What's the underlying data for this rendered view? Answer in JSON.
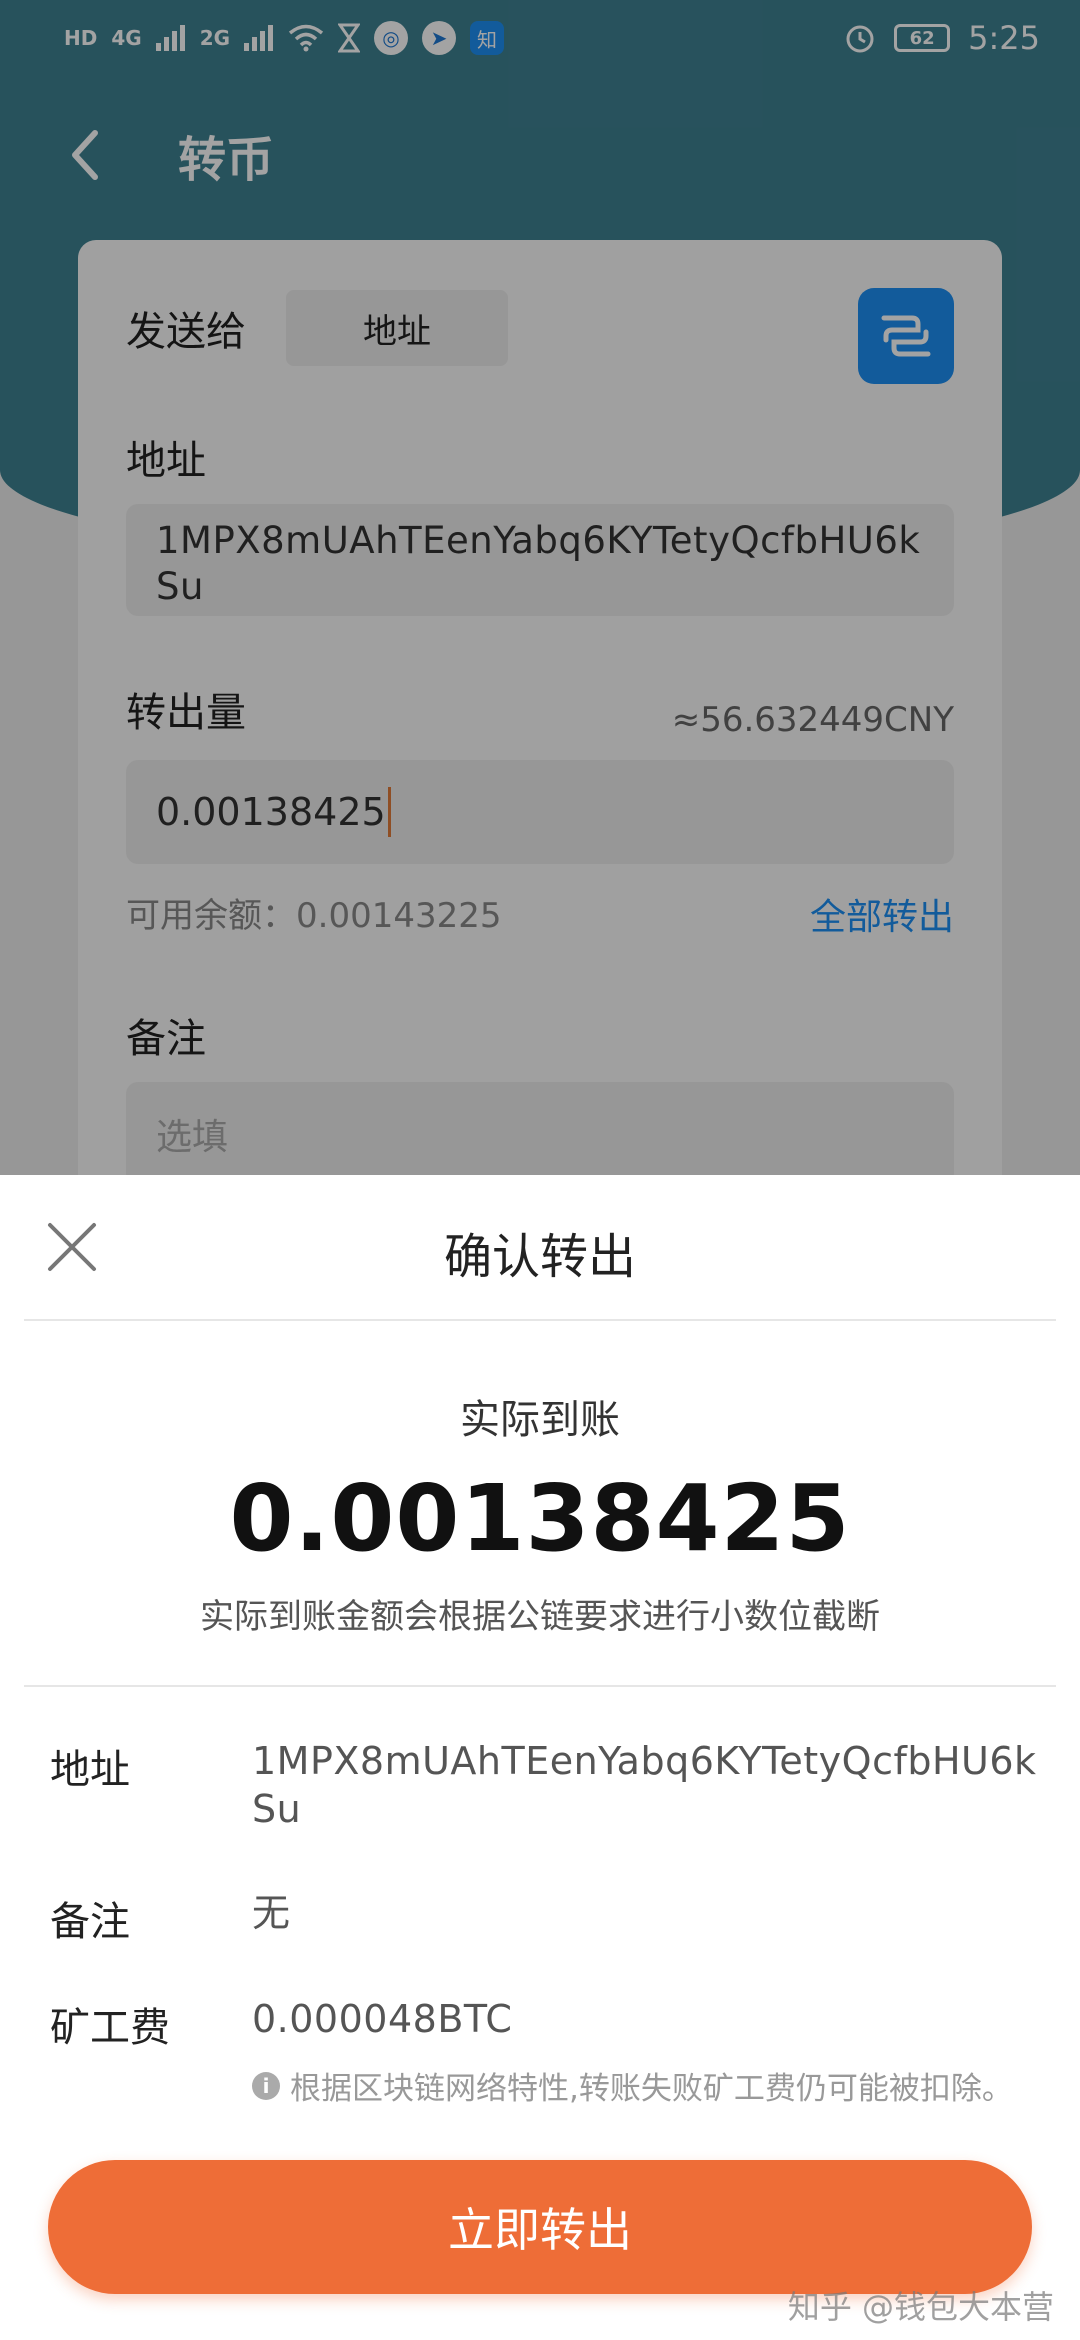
{
  "status_bar": {
    "left_chips": [
      "HD",
      "4G",
      "2G"
    ],
    "app_badge": "知",
    "battery": "62",
    "time": "5:25"
  },
  "nav": {
    "title": "转币"
  },
  "form": {
    "send_to_label": "发送给",
    "send_to_chip": "地址",
    "address_label": "地址",
    "address_value": "1MPX8mUAhTEenYabq6KYTetyQcfbHU6kSu",
    "amount_label": "转出量",
    "cny_estimate": "≈56.632449CNY",
    "amount_value": "0.00138425",
    "balance_text": "可用余额：0.00143225",
    "transfer_all": "全部转出",
    "memo_label": "备注",
    "memo_placeholder": "选填"
  },
  "sheet": {
    "title": "确认转出",
    "arrival_label": "实际到账",
    "arrival_value": "0.00138425",
    "arrival_note": "实际到账金额会根据公链要求进行小数位截断",
    "details": {
      "address_label": "地址",
      "address_value": "1MPX8mUAhTEenYabq6KYTetyQcfbHU6kSu",
      "memo_label": "备注",
      "memo_value": "无",
      "fee_label": "矿工费",
      "fee_value": "0.000048BTC",
      "fee_note": "根据区块链网络特性,转账失败矿工费仍可能被扣除。"
    },
    "submit_label": "立即转出"
  },
  "watermark": "知乎 @钱包大本营",
  "colors": {
    "header_teal": "#3e8191",
    "accent_blue": "#1d8ff2",
    "submit_orange": "#ee6d37"
  }
}
